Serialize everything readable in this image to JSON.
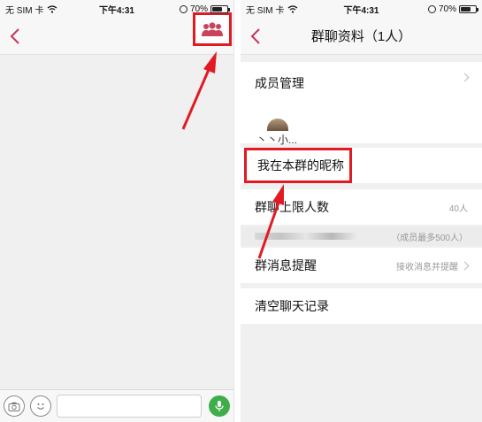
{
  "left_screen": {
    "status_bar": {
      "carrier": "无 SIM 卡",
      "time": "下午4:31",
      "battery": "70%"
    },
    "nav": {
      "back_icon": "chevron-left-icon",
      "group_icon": "group-members-icon"
    },
    "input_bar": {
      "camera_icon": "camera-icon",
      "emoji_icon": "emoji-icon",
      "mic_icon": "microphone-icon"
    }
  },
  "right_screen": {
    "status_bar": {
      "carrier": "无 SIM 卡",
      "time": "下午4:31",
      "battery": "70%"
    },
    "nav": {
      "title": "群聊资料（1人）",
      "back_icon": "chevron-left-icon"
    },
    "member_manage": {
      "label": "成员管理"
    },
    "member_name": "丶丶小...",
    "nickname": {
      "label": "我在本群的昵称"
    },
    "group_limit": {
      "label": "群聊上限人数",
      "value": "40人"
    },
    "limit_hint": {
      "value": "（成员最多500人）"
    },
    "message_remind": {
      "label": "群消息提醒",
      "value": "接收消息并提醒"
    },
    "clear_history": {
      "label": "清空聊天记录"
    }
  },
  "battery_level_pct": 70,
  "colors": {
    "accent_red": "#e01b24",
    "group_icon": "#c9445a",
    "mic_green": "#3fae49",
    "back_chevron": "#c7355a"
  }
}
